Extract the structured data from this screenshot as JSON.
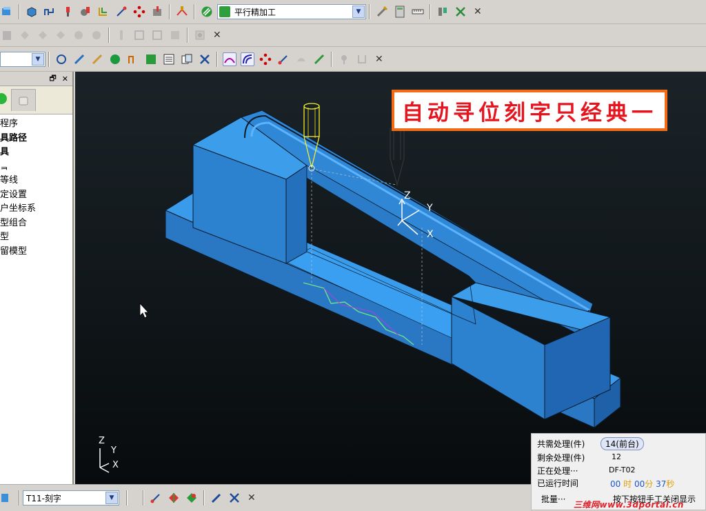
{
  "toolbar1": {
    "strategy_combo_value": "平行精加工"
  },
  "combo_row3": {
    "value": ""
  },
  "explorer": {
    "items": [
      {
        "label": "程序",
        "bold": false
      },
      {
        "label": "具路径",
        "bold": true
      },
      {
        "label": "具",
        "bold": true
      },
      {
        "label": "ᆿ",
        "bold": false
      },
      {
        "label": "等线",
        "bold": false
      },
      {
        "label": "定设置",
        "bold": false
      },
      {
        "label": "户坐标系",
        "bold": false
      },
      {
        "label": "型组合",
        "bold": false
      },
      {
        "label": "型",
        "bold": false
      },
      {
        "label": "留模型",
        "bold": false
      }
    ]
  },
  "viewport": {
    "banner_text": "自动寻位刻字只经典一",
    "axis_z": "Z",
    "axis_y": "Y",
    "axis_x": "X",
    "corner_z": "Z",
    "corner_y": "Y",
    "corner_x": "X"
  },
  "status": {
    "total_label": "共需处理(件)",
    "total_value": "14(前台)",
    "remain_label": "剩余处理(件)",
    "remain_value": "12",
    "processing_label": "正在处理···",
    "processing_value": "DF-T02",
    "elapsed_label": "已运行时间",
    "hours": "00",
    "hours_unit": "时",
    "minutes": "00",
    "minutes_unit": "分",
    "seconds": "37",
    "seconds_unit": "秒",
    "batch_label": "批量···",
    "tip_label": "按下按钮手工关闭显示"
  },
  "bottombar": {
    "tool_combo_value": "T11-刻字"
  },
  "watermark": "三维网www.3dportal.cn",
  "colors": {
    "part_blue": "#2f8fdc",
    "banner_orange": "#f26b16",
    "banner_text": "#e5141e",
    "tool_yellow": "#f2ee2a",
    "viewport_bg": "#11181c"
  }
}
